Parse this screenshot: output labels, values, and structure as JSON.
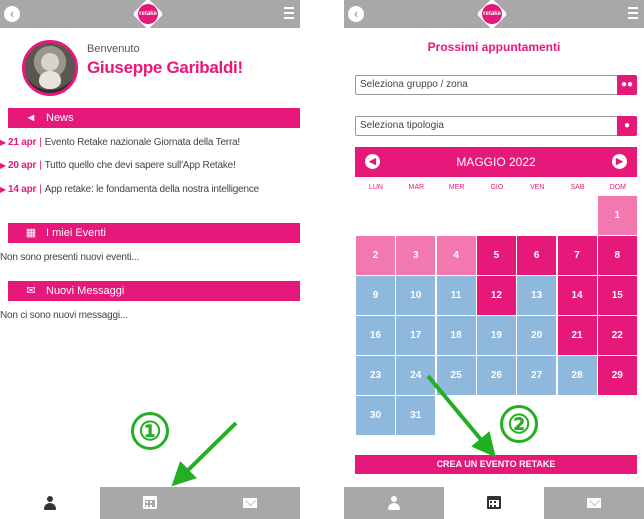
{
  "colors": {
    "accent": "#e6197a",
    "light_pink": "#f279b0",
    "blue": "#8fb8dd",
    "bar_gray": "#a8a8a8",
    "annotation_green": "#22b022"
  },
  "app": {
    "logo_text": "retake",
    "back_icon": "back-circle-icon",
    "menu_icon": "hamburger-icon"
  },
  "left": {
    "welcome": "Benvenuto",
    "user_name": "Giuseppe Garibaldi!",
    "news_title": "News",
    "news": [
      {
        "date": "21 apr",
        "text": "Evento Retake nazionale Giornata della Terra!"
      },
      {
        "date": "20 apr",
        "text": "Tutto quello che devi sapere sull'App Retake!"
      },
      {
        "date": "14 apr",
        "text": "App retake: le fondamenta della nostra intelligence"
      }
    ],
    "news_separator": "|",
    "events_title": "I miei Eventi",
    "events_empty": "Non sono presenti nuovi eventi...",
    "messages_title": "Nuovi Messaggi",
    "messages_empty": "Non ci sono nuovi messaggi..."
  },
  "right": {
    "title": "Prossimi appuntamenti",
    "select_group_placeholder": "Seleziona gruppo / zona",
    "select_type_placeholder": "Seleziona tipologia",
    "calendar": {
      "month_label": "MAGGIO 2022",
      "weekdays": [
        "LUN",
        "MAR",
        "MER",
        "GIO",
        "VEN",
        "SAB",
        "DOM"
      ],
      "days": [
        {
          "n": "1",
          "col": 6,
          "row": 0,
          "state": "light"
        },
        {
          "n": "2",
          "col": 0,
          "row": 1,
          "state": "light"
        },
        {
          "n": "3",
          "col": 1,
          "row": 1,
          "state": "light"
        },
        {
          "n": "4",
          "col": 2,
          "row": 1,
          "state": "light"
        },
        {
          "n": "5",
          "col": 3,
          "row": 1,
          "state": "event"
        },
        {
          "n": "6",
          "col": 4,
          "row": 1,
          "state": "event"
        },
        {
          "n": "7",
          "col": 5,
          "row": 1,
          "state": "event"
        },
        {
          "n": "8",
          "col": 6,
          "row": 1,
          "state": "event"
        },
        {
          "n": "9",
          "col": 0,
          "row": 2,
          "state": "free"
        },
        {
          "n": "10",
          "col": 1,
          "row": 2,
          "state": "free"
        },
        {
          "n": "11",
          "col": 2,
          "row": 2,
          "state": "free"
        },
        {
          "n": "12",
          "col": 3,
          "row": 2,
          "state": "event"
        },
        {
          "n": "13",
          "col": 4,
          "row": 2,
          "state": "free"
        },
        {
          "n": "14",
          "col": 5,
          "row": 2,
          "state": "event"
        },
        {
          "n": "15",
          "col": 6,
          "row": 2,
          "state": "event"
        },
        {
          "n": "16",
          "col": 0,
          "row": 3,
          "state": "free"
        },
        {
          "n": "17",
          "col": 1,
          "row": 3,
          "state": "free"
        },
        {
          "n": "18",
          "col": 2,
          "row": 3,
          "state": "free"
        },
        {
          "n": "19",
          "col": 3,
          "row": 3,
          "state": "free"
        },
        {
          "n": "20",
          "col": 4,
          "row": 3,
          "state": "free"
        },
        {
          "n": "21",
          "col": 5,
          "row": 3,
          "state": "event"
        },
        {
          "n": "22",
          "col": 6,
          "row": 3,
          "state": "event"
        },
        {
          "n": "23",
          "col": 0,
          "row": 4,
          "state": "free"
        },
        {
          "n": "24",
          "col": 1,
          "row": 4,
          "state": "free"
        },
        {
          "n": "25",
          "col": 2,
          "row": 4,
          "state": "free"
        },
        {
          "n": "26",
          "col": 3,
          "row": 4,
          "state": "free"
        },
        {
          "n": "27",
          "col": 4,
          "row": 4,
          "state": "free"
        },
        {
          "n": "28",
          "col": 5,
          "row": 4,
          "state": "free"
        },
        {
          "n": "29",
          "col": 6,
          "row": 4,
          "state": "event"
        },
        {
          "n": "30",
          "col": 0,
          "row": 5,
          "state": "free"
        },
        {
          "n": "31",
          "col": 1,
          "row": 5,
          "state": "free"
        }
      ]
    },
    "create_button": "CREA UN EVENTO RETAKE"
  },
  "annotations": {
    "step1": "①",
    "step2": "②"
  }
}
